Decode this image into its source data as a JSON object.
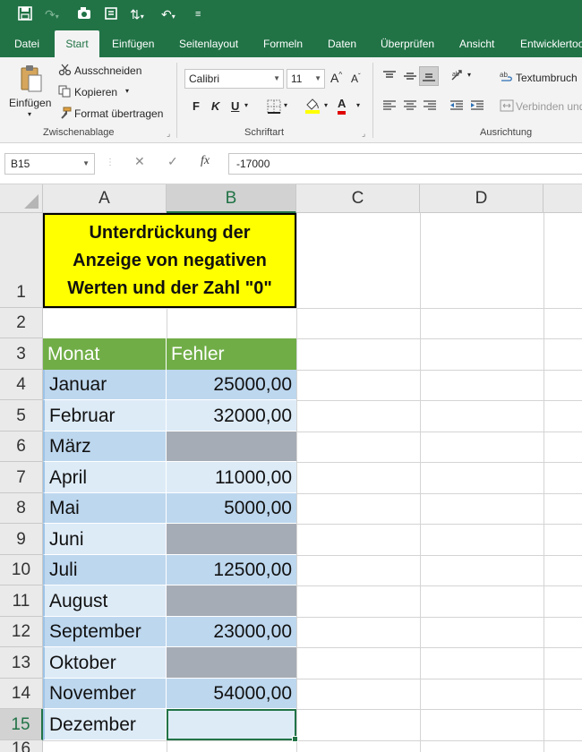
{
  "colors": {
    "excel_green": "#217346",
    "title_fill": "#ffff00",
    "header_fill": "#70ad47",
    "row_light": "#ddebf7",
    "row_dark": "#bdd7ee",
    "hidden_fill": "#a6acb5"
  },
  "qat_icons": [
    "save-icon",
    "redo-icon",
    "touch-mode-icon",
    "form-icon",
    "sort-icon",
    "undo-icon",
    "customize-icon"
  ],
  "tabs": [
    "Datei",
    "Start",
    "Einfügen",
    "Seitenlayout",
    "Formeln",
    "Daten",
    "Überprüfen",
    "Ansicht",
    "Entwicklertoo"
  ],
  "active_tab": "Start",
  "ribbon": {
    "clipboard": {
      "paste": "Einfügen",
      "cut": "Ausschneiden",
      "copy": "Kopieren",
      "format_painter": "Format übertragen",
      "label": "Zwischenablage"
    },
    "font": {
      "name": "Calibri",
      "size": "11",
      "bold": "F",
      "italic": "K",
      "underline": "U",
      "grow": "A",
      "shrink": "A",
      "font_color_letter": "A",
      "label": "Schriftart"
    },
    "alignment": {
      "wrap": "Textumbruch",
      "merge": "Verbinden und",
      "label": "Ausrichtung"
    }
  },
  "formula_bar": {
    "name_box": "B15",
    "cancel": "✕",
    "enter": "✓",
    "fx": "fx",
    "formula": "-17000"
  },
  "sheet": {
    "columns": [
      "A",
      "B",
      "C",
      "D"
    ],
    "rows": [
      "1",
      "2",
      "3",
      "4",
      "5",
      "6",
      "7",
      "8",
      "9",
      "10",
      "11",
      "12",
      "13",
      "14",
      "15",
      "16"
    ],
    "selected_cell": "B15",
    "title": [
      "Unterdrückung der",
      "Anzeige von negativen",
      "Werten und der Zahl \"0\""
    ],
    "header": {
      "month": "Monat",
      "errors": "Fehler"
    },
    "data": [
      {
        "row": "4",
        "month": "Januar",
        "value": "25000,00",
        "hidden": false
      },
      {
        "row": "5",
        "month": "Februar",
        "value": "32000,00",
        "hidden": false
      },
      {
        "row": "6",
        "month": "März",
        "value": "",
        "hidden": true
      },
      {
        "row": "7",
        "month": "April",
        "value": "11000,00",
        "hidden": false
      },
      {
        "row": "8",
        "month": "Mai",
        "value": "5000,00",
        "hidden": false
      },
      {
        "row": "9",
        "month": "Juni",
        "value": "",
        "hidden": true
      },
      {
        "row": "10",
        "month": "Juli",
        "value": "12500,00",
        "hidden": false
      },
      {
        "row": "11",
        "month": "August",
        "value": "",
        "hidden": true
      },
      {
        "row": "12",
        "month": "September",
        "value": "23000,00",
        "hidden": false
      },
      {
        "row": "13",
        "month": "Oktober",
        "value": "",
        "hidden": true
      },
      {
        "row": "14",
        "month": "November",
        "value": "54000,00",
        "hidden": false
      },
      {
        "row": "15",
        "month": "Dezember",
        "value": "",
        "hidden": false
      }
    ]
  }
}
